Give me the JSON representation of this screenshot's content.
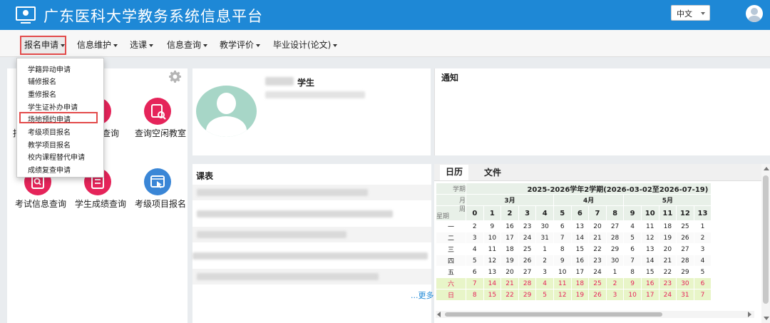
{
  "header": {
    "title": "广东医科大学教务系统信息平台",
    "language": "中文"
  },
  "nav": {
    "items": [
      {
        "label": "报名申请"
      },
      {
        "label": "信息维护"
      },
      {
        "label": "选课"
      },
      {
        "label": "信息查询"
      },
      {
        "label": "教学评价"
      },
      {
        "label": "毕业设计(论文)"
      }
    ]
  },
  "dropdown": {
    "items": [
      {
        "label": "学籍异动申请"
      },
      {
        "label": "辅修报名"
      },
      {
        "label": "重修报名"
      },
      {
        "label": "学生证补办申请"
      },
      {
        "label": "场地预约申请"
      },
      {
        "label": "考级项目报名"
      },
      {
        "label": "教学项目报名"
      },
      {
        "label": "校内课程替代申请"
      },
      {
        "label": "成绩复查申请"
      }
    ]
  },
  "apps": {
    "items": [
      {
        "label": "查询空闲教室",
        "color": "#e5245a",
        "icon": "classroom-icon"
      },
      {
        "label": "考试信息查询",
        "color": "#e5245a",
        "icon": "search-doc-icon"
      },
      {
        "label": "学生成绩查询",
        "color": "#e5245a",
        "icon": "grades-icon"
      },
      {
        "label": "考级项目报名",
        "color": "#3a86d6",
        "icon": "cursor-window-icon"
      }
    ],
    "partial_label": "查询"
  },
  "profile": {
    "role": "学生"
  },
  "notice": {
    "title": "通知"
  },
  "schedule": {
    "title": "课表",
    "more": "...更多"
  },
  "calendar": {
    "tabs": [
      "日历",
      "文件"
    ],
    "corner": {
      "term": "学期",
      "month": "月",
      "week": "周",
      "weekday": "星期"
    },
    "term_title": "2025-2026学年2学期(2026-03-02至2026-07-19)",
    "months": [
      {
        "label": "3月",
        "span": 5
      },
      {
        "label": "4月",
        "span": 4
      },
      {
        "label": "5月",
        "span": 5
      }
    ],
    "weeks": [
      "0",
      "1",
      "2",
      "3",
      "4",
      "5",
      "6",
      "7",
      "8",
      "9",
      "10",
      "11",
      "12",
      "13"
    ],
    "rows": [
      {
        "day": "一",
        "weekend": false,
        "cells": [
          "2",
          "9",
          "16",
          "23",
          "30",
          "6",
          "13",
          "20",
          "27",
          "4",
          "11",
          "18",
          "25",
          "1"
        ]
      },
      {
        "day": "二",
        "weekend": false,
        "cells": [
          "3",
          "10",
          "17",
          "24",
          "31",
          "7",
          "14",
          "21",
          "28",
          "5",
          "12",
          "19",
          "26",
          "2"
        ]
      },
      {
        "day": "三",
        "weekend": false,
        "cells": [
          "4",
          "11",
          "18",
          "25",
          "1",
          "8",
          "15",
          "22",
          "29",
          "6",
          "13",
          "20",
          "27",
          "3"
        ]
      },
      {
        "day": "四",
        "weekend": false,
        "cells": [
          "5",
          "12",
          "19",
          "26",
          "2",
          "9",
          "16",
          "23",
          "30",
          "7",
          "14",
          "21",
          "28",
          "4"
        ]
      },
      {
        "day": "五",
        "weekend": false,
        "cells": [
          "6",
          "13",
          "20",
          "27",
          "3",
          "10",
          "17",
          "24",
          "1",
          "8",
          "15",
          "22",
          "29",
          "5"
        ]
      },
      {
        "day": "六",
        "weekend": true,
        "cells": [
          "7",
          "14",
          "21",
          "28",
          "4",
          "11",
          "18",
          "25",
          "2",
          "9",
          "16",
          "23",
          "30",
          "6"
        ]
      },
      {
        "day": "日",
        "weekend": true,
        "cells": [
          "8",
          "15",
          "22",
          "29",
          "5",
          "12",
          "19",
          "26",
          "3",
          "10",
          "17",
          "24",
          "31",
          "7"
        ]
      }
    ]
  },
  "colors": {
    "header_bg": "#1e88d6",
    "highlight": "#e34b4b",
    "weekend_text": "#e5245a",
    "weekend_bg": "#e8f5c8",
    "cal_header_bg": "#e8f0e8"
  }
}
